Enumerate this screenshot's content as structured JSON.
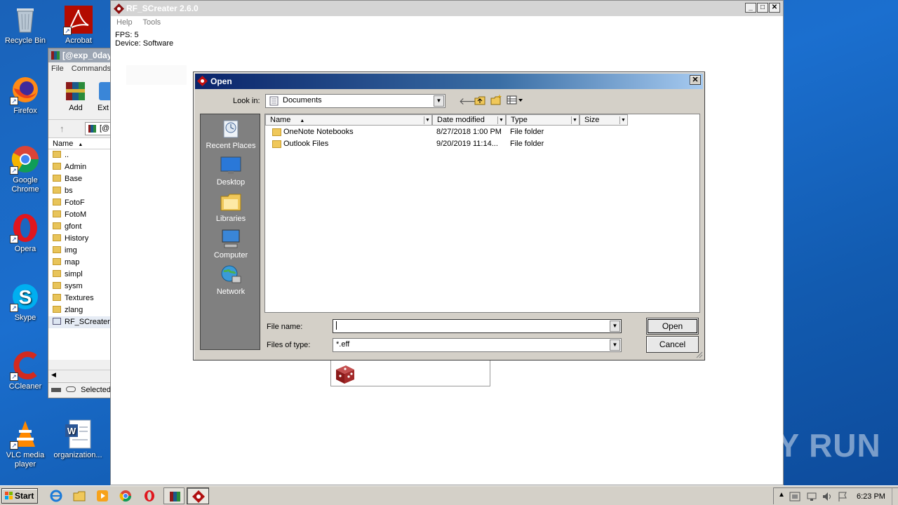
{
  "desktop": {
    "icons": [
      {
        "label": "Recycle Bin"
      },
      {
        "label": "Acrobat"
      },
      {
        "label": "Firefox"
      },
      {
        "label": "Google Chrome"
      },
      {
        "label": "Opera"
      },
      {
        "label": "Skype"
      },
      {
        "label": "CCleaner"
      },
      {
        "label": "VLC media player"
      },
      {
        "label": "organization..."
      }
    ]
  },
  "winrar": {
    "title": "[@exp_0day",
    "menu": [
      "File",
      "Commands"
    ],
    "toolbar": [
      "Add",
      "Ext"
    ],
    "address": "[@",
    "column_name": "Name",
    "rows": [
      "..",
      "Admin",
      "Base",
      "bs",
      "FotoF",
      "FotoM",
      "gfont",
      "History",
      "img",
      "map",
      "simpl",
      "sysm",
      "Textures",
      "zlang",
      "RF_SCreater"
    ],
    "status": "Selected"
  },
  "app": {
    "title": "RF_SCreater 2.6.0",
    "menu": [
      "Help",
      "Tools"
    ],
    "fps": "FPS: 5",
    "device": "Device: Software"
  },
  "dialog": {
    "title": "Open",
    "look_in_label": "Look in:",
    "look_in_value": "Documents",
    "places": [
      "Recent Places",
      "Desktop",
      "Libraries",
      "Computer",
      "Network"
    ],
    "columns": [
      "Name",
      "Date modified",
      "Type",
      "Size"
    ],
    "files": [
      {
        "name": "OneNote Notebooks",
        "date": "8/27/2018 1:00 PM",
        "type": "File folder"
      },
      {
        "name": "Outlook Files",
        "date": "9/20/2019 11:14...",
        "type": "File folder"
      }
    ],
    "file_name_label": "File name:",
    "file_name_value": "",
    "file_type_label": "Files of type:",
    "file_type_value": "*.eff",
    "open_button": "Open",
    "cancel_button": "Cancel"
  },
  "taskbar": {
    "start": "Start",
    "clock": "6:23 PM"
  },
  "watermark": "ANY RUN"
}
